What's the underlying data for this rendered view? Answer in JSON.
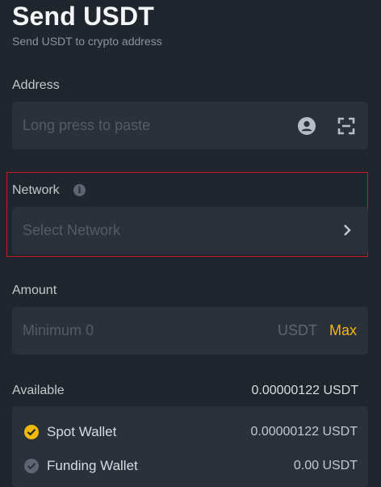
{
  "header": {
    "title": "Send USDT",
    "subtitle": "Send USDT to crypto address"
  },
  "address": {
    "label": "Address",
    "placeholder": "Long press to paste",
    "icons": [
      "contact-book-icon",
      "scan-qr-icon"
    ]
  },
  "network": {
    "label": "Network",
    "placeholder": "Select Network",
    "info_icon_glyph": "i",
    "highlight_color": "#d1161f"
  },
  "amount": {
    "label": "Amount",
    "placeholder": "Minimum 0",
    "unit": "USDT",
    "max_label": "Max",
    "accent_color": "#f0b90b"
  },
  "available": {
    "label": "Available",
    "value": "0.00000122 USDT",
    "wallets": [
      {
        "name": "Spot Wallet",
        "amount": "0.00000122 USDT",
        "selected": true
      },
      {
        "name": "Funding Wallet",
        "amount": "0.00 USDT",
        "selected": false
      }
    ]
  }
}
